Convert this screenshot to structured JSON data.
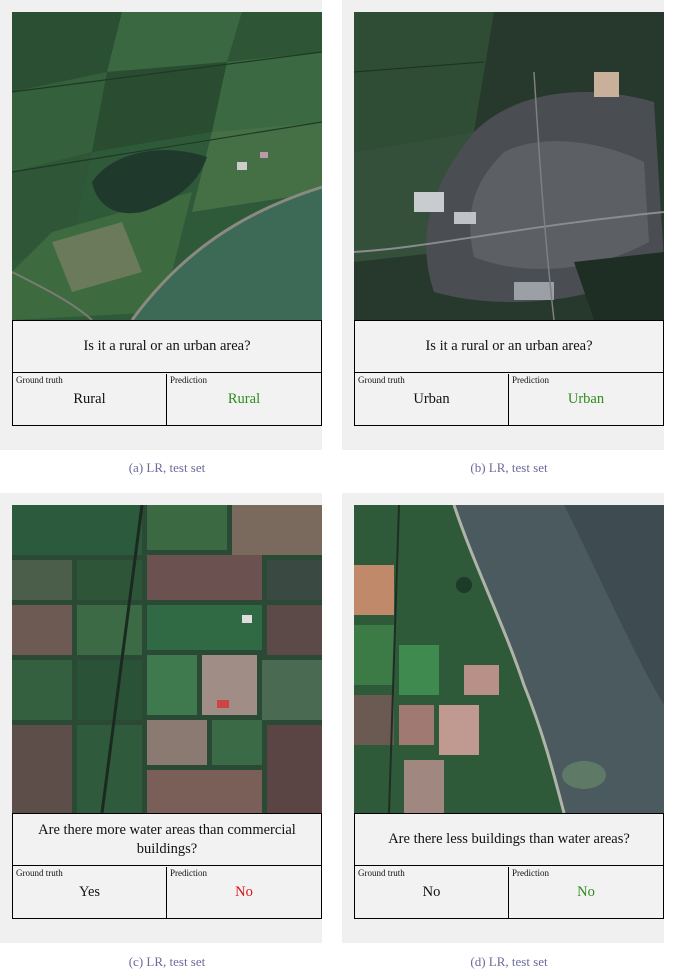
{
  "labels": {
    "ground_truth": "Ground truth",
    "prediction": "Prediction"
  },
  "panels": [
    {
      "question": "Is it a rural or an urban area?",
      "ground_truth": "Rural",
      "prediction": "Rural",
      "correct": true,
      "caption": "(a) LR, test set",
      "image": "farmland-with-pond"
    },
    {
      "question": "Is it a rural or an urban area?",
      "ground_truth": "Urban",
      "prediction": "Urban",
      "correct": true,
      "caption": "(b) LR, test set",
      "image": "town-aerial"
    },
    {
      "question": "Are there more water areas than commercial buildings?",
      "ground_truth": "Yes",
      "prediction": "No",
      "correct": false,
      "caption": "(c) LR, test set",
      "image": "field-grid"
    },
    {
      "question": "Are there less buildings than water areas?",
      "ground_truth": "No",
      "prediction": "No",
      "correct": true,
      "caption": "(d) LR, test set",
      "image": "coastline-fields"
    }
  ],
  "colors": {
    "correct": "#2e8b1e",
    "incorrect": "#dd1111",
    "caption": "#6b6a9c"
  }
}
